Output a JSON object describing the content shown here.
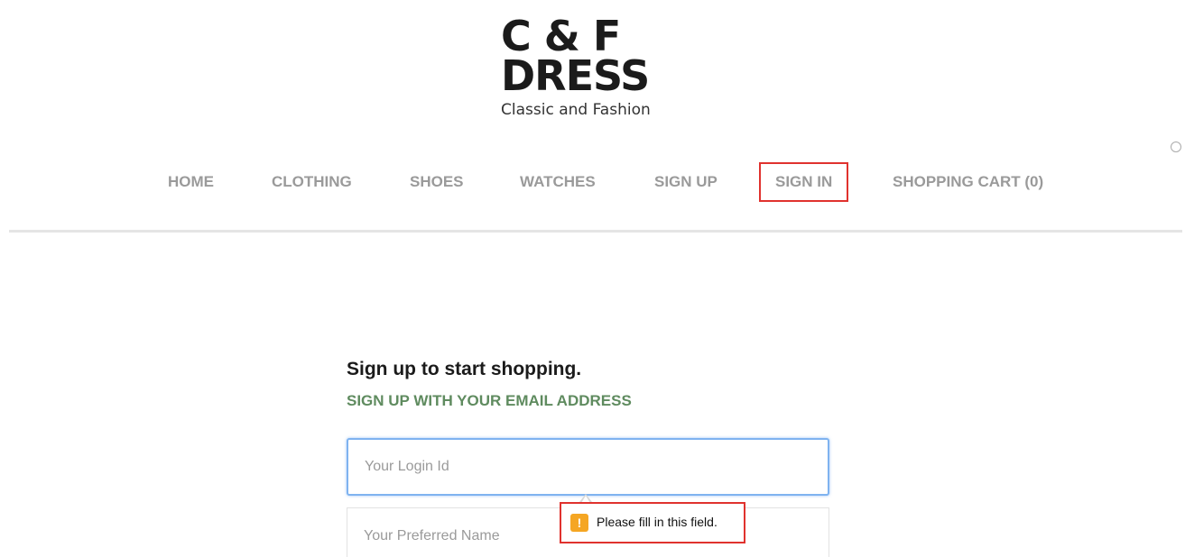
{
  "logo": {
    "line1": "C & F",
    "line2": "DRESS",
    "tagline": "Classic and Fashion"
  },
  "nav": {
    "items": [
      {
        "label": "HOME"
      },
      {
        "label": "CLOTHING"
      },
      {
        "label": "SHOES"
      },
      {
        "label": "WATCHES"
      },
      {
        "label": "SIGN UP"
      },
      {
        "label": "SIGN IN"
      },
      {
        "label": "SHOPPING CART (0)"
      }
    ]
  },
  "form": {
    "title": "Sign up to start shopping.",
    "subtitle": "SIGN UP WITH YOUR EMAIL ADDRESS",
    "login_placeholder": "Your Login Id",
    "name_placeholder": "Your Preferred Name"
  },
  "tooltip": {
    "icon": "!",
    "message": "Please fill in this field."
  },
  "colors": {
    "highlight": "#e0322e",
    "subtitle": "#5f8b5f",
    "nav_text": "#9a9a9a",
    "warning": "#f5a623"
  }
}
